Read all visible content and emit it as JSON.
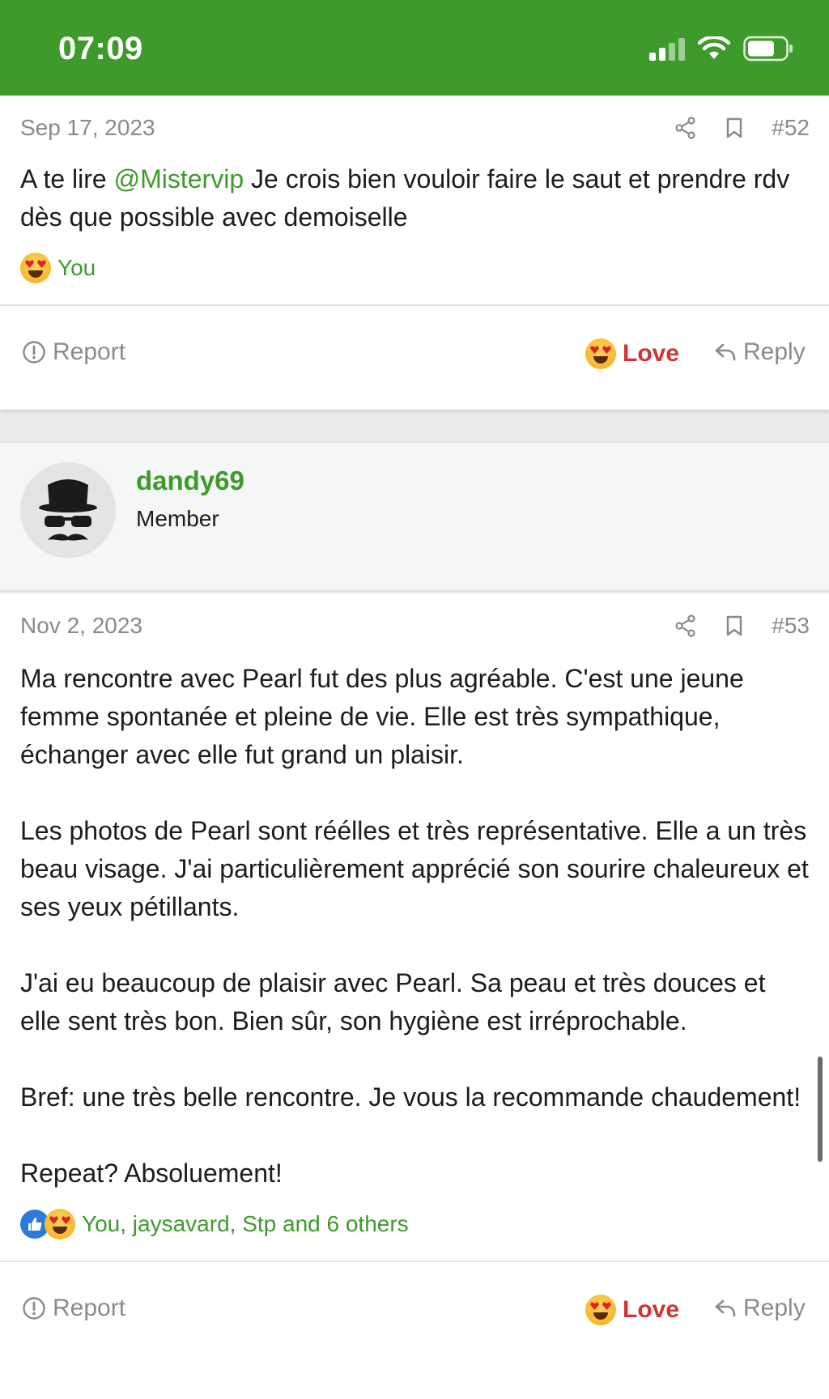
{
  "status_bar": {
    "time": "07:09",
    "icons": [
      "signal-icon",
      "wifi-icon",
      "battery-icon"
    ]
  },
  "post52": {
    "date": "Sep 17, 2023",
    "number": "#52",
    "body_prefix": "A te lire ",
    "mention": "@Mistervip",
    "body_suffix": " Je crois bien vouloir faire le saut et prendre rdv dès que possible avec demoiselle",
    "reactions_text": "You",
    "actions": {
      "report": "Report",
      "love": "Love",
      "reply": "Reply"
    }
  },
  "user": {
    "name": "dandy69",
    "title": "Member"
  },
  "post53": {
    "date": "Nov 2, 2023",
    "number": "#53",
    "paragraphs": [
      "Ma rencontre avec Pearl fut des plus agréable. C'est une jeune femme spontanée et pleine de vie. Elle est très sympathique, échanger avec elle fut grand un plaisir.",
      "Les photos de Pearl sont réélles et très représentative. Elle a un très beau visage. J'ai particulièrement apprécié son sourire chaleureux et ses yeux pétillants.",
      "J'ai eu beaucoup de plaisir avec Pearl. Sa peau et très douces et elle sent très bon. Bien sûr, son hygiène est irréprochable.",
      "Bref: une très belle rencontre. Je vous la recommande chaudement!",
      "Repeat? Absoluement!"
    ],
    "reactions_text": "You, jaysavard, Stp and 6 others",
    "actions": {
      "report": "Report",
      "love": "Love",
      "reply": "Reply"
    }
  },
  "colors": {
    "brand_green": "#3f9a2c",
    "love_red": "#d03434",
    "muted_gray": "#8a8a8a"
  }
}
